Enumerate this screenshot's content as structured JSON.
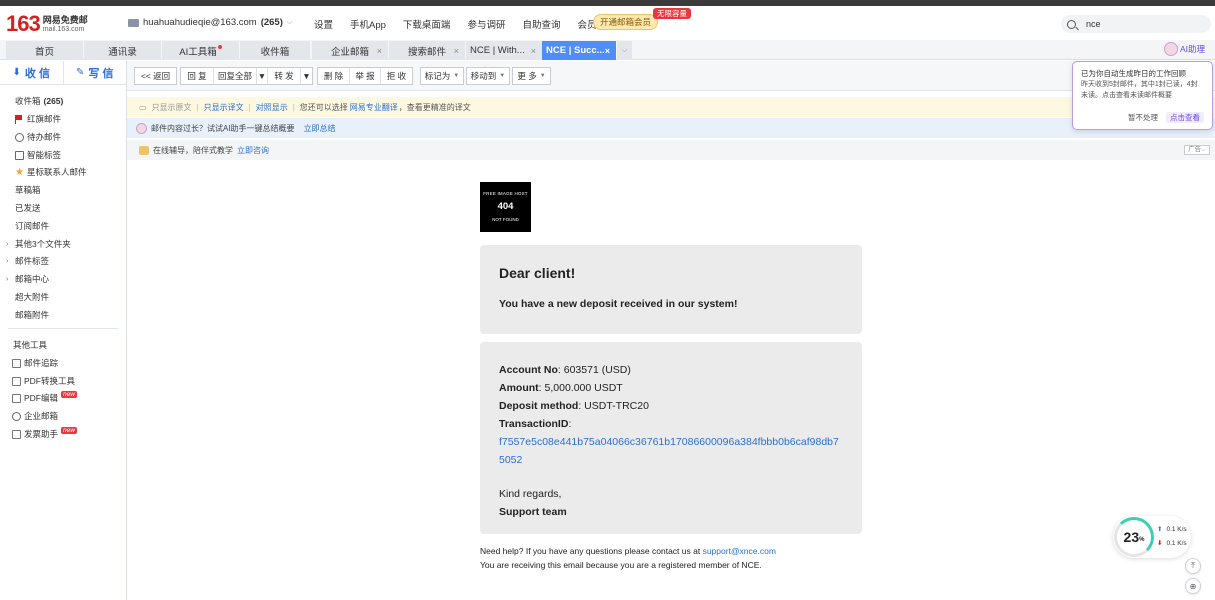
{
  "header": {
    "logo_num": "163",
    "logo_cn": "网易免费邮",
    "logo_domain": "mail.163.com",
    "account_email": "huahuahudieqie@163.com",
    "account_count": "(265)",
    "nav": [
      "设置",
      "手机App",
      "下载桌面端",
      "参与调研",
      "自助查询",
      "会员中心"
    ],
    "vip_label": "开通邮箱会员",
    "vip_badge": "无限容量",
    "search_value": "nce"
  },
  "tabs": [
    {
      "label": "首页"
    },
    {
      "label": "通讯录"
    },
    {
      "label": "AI工具箱"
    },
    {
      "label": "收件箱"
    },
    {
      "label": "企业邮箱"
    },
    {
      "label": "搜索邮件"
    },
    {
      "label": "NCE | With..."
    },
    {
      "label": "NCE | Succ..."
    }
  ],
  "ai_helper_label": "AI助理",
  "sidebar": {
    "receive": "收 信",
    "write": "写 信",
    "inbox": "收件箱",
    "inbox_count": "(265)",
    "items": [
      "红旗邮件",
      "待办邮件",
      "智能标签",
      "星标联系人邮件",
      "草稿箱",
      "已发送",
      "订阅邮件",
      "其他3个文件夹",
      "邮件标签",
      "邮箱中心",
      "超大附件",
      "邮箱附件"
    ],
    "tools_title": "其他工具",
    "tools": [
      "邮件追踪",
      "PDF转换工具",
      "PDF编辑",
      "企业邮箱",
      "发票助手"
    ],
    "new_badge": "new"
  },
  "toolbar": {
    "back": "<< 返回",
    "reply": "回 复",
    "reply_all": "回复全部",
    "forward": "转 发",
    "delete": "删 除",
    "report": "举 报",
    "reject": "拒 收",
    "mark": "标记为",
    "move": "移动到",
    "more": "更 多"
  },
  "translate_bar": {
    "show_original": "只显示原文",
    "show_translation": "只显示译文",
    "compare": "对照显示",
    "hint": "您还可以选择",
    "pro": "网易专业翻译",
    "hint2": "，查看更精准的译文"
  },
  "ai_bar": {
    "text": "邮件内容过长？试试AI助手一键总结概要",
    "link": "立即总结"
  },
  "ad_bar": {
    "text": "在线辅导，陪伴式教学",
    "link": "立即咨询",
    "tag": "广告"
  },
  "popup": {
    "title": "已为你自动生成昨日的工作回顾",
    "body": "昨天收到5封邮件，其中1封已读，4封未读。点击查看未读邮件概要",
    "skip": "暂不处理",
    "go": "点击查看"
  },
  "email": {
    "img_line1": "FREE IMAGE HOST",
    "img_line2": "404",
    "img_line3": "NOT FOUND",
    "greeting": "Dear client!",
    "headline": "You have a new deposit received in our system!",
    "account_label": "Account No",
    "account_value": ": 603571 (USD)",
    "amount_label": "Amount",
    "amount_value": ": 5,000.000 USDT",
    "method_label": "Deposit method",
    "method_value": ": USDT-TRC20",
    "txid_label": "TransactionID",
    "txid_colon": ":",
    "txid_value": "f7557e5c08e441b75a04066c36761b17086600096a384fbbb0b6caf98db75052",
    "regards": "Kind regards,",
    "team": "Support team",
    "help_prefix": "Need help? If you have any questions please contact us at ",
    "help_email": "support@xnce.com",
    "registered": "You are receiving this email because you are a registered member of NCE."
  },
  "perf": {
    "percent": "23",
    "unit": "%",
    "up": "0.1 K/s",
    "down": "0.1 K/s"
  }
}
